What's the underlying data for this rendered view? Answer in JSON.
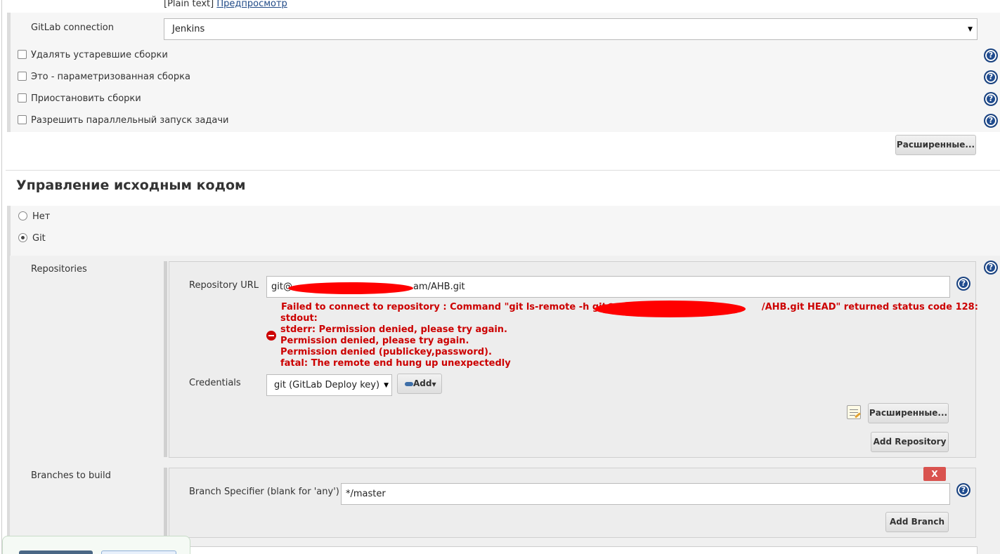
{
  "top": {
    "plain_text": "[Plain text]",
    "preview_link": "Предпросмотр"
  },
  "gitlab": {
    "label": "GitLab connection",
    "value": "Jenkins"
  },
  "options": [
    {
      "label": "Удалять устаревшие сборки"
    },
    {
      "label": "Это - параметризованная сборка"
    },
    {
      "label": "Приостановить сборки"
    },
    {
      "label": "Разрешить параллельный запуск задачи"
    }
  ],
  "advanced_label": "Расширенные...",
  "scm": {
    "heading": "Управление исходным кодом",
    "none_label": "Нет",
    "git_label": "Git",
    "selected": "Git"
  },
  "repositories": {
    "label": "Repositories",
    "url_label": "Repository URL",
    "url_prefix": "git@",
    "url_suffix": "am/AHB.git",
    "error": {
      "line1_prefix": "Failed to connect to repository : Command \"git ls-remote -h git@",
      "line1_suffix": "/AHB.git HEAD\" returned status code 128:",
      "line2": "stdout:",
      "line3": "stderr: Permission denied, please try again.",
      "line4": "Permission denied, please try again.",
      "line5": "Permission denied (publickey,password).",
      "line6": "fatal: The remote end hung up unexpectedly"
    },
    "credentials_label": "Credentials",
    "credentials_value": "git (GitLab Deploy key)",
    "add_label": "Add",
    "advanced_label": "Расширенные...",
    "add_repository_label": "Add Repository"
  },
  "branches": {
    "label": "Branches to build",
    "delete_label": "X",
    "specifier_label": "Branch Specifier (blank for 'any')",
    "specifier_value": "*/master",
    "add_branch_label": "Add Branch"
  },
  "colors": {
    "error": "#cc0000",
    "redaction": "#ff0000",
    "delete_button": "#d9534f"
  }
}
